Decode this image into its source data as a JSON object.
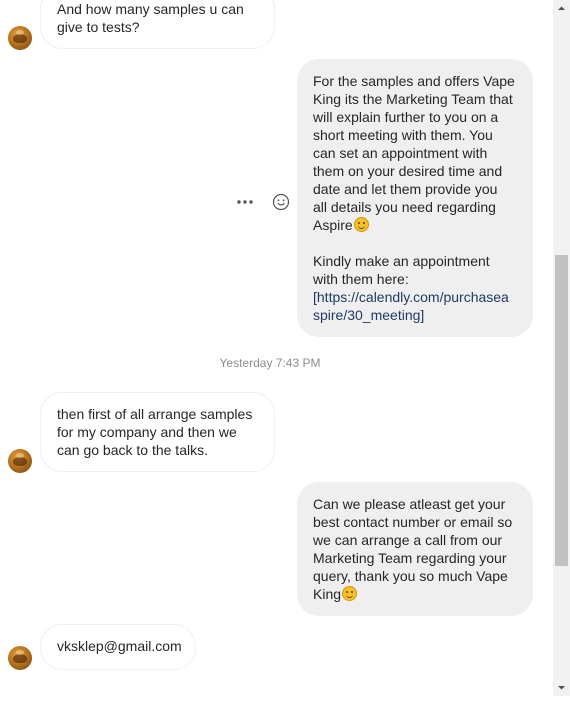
{
  "messages": [
    {
      "direction": "incoming",
      "lines": [
        "And how many samples u can",
        "give to tests?"
      ]
    },
    {
      "direction": "outgoing",
      "lines": [
        "For the samples and offers Vape",
        "King its the Marketing Team that",
        "will explain further to you on a",
        "short meeting with them. You",
        "can set an appointment with",
        "them on your desired time and",
        "date and let them provide you",
        "all details you need regarding",
        "Aspire"
      ],
      "lines2": [
        "Kindly make an appointment",
        "with them here:"
      ],
      "link_lines": [
        "[https://calendly.com/purchasea",
        "spire/30_meeting]"
      ]
    },
    {
      "direction": "incoming",
      "lines": [
        "then first of all arrange samples",
        "for my company and then we",
        "can go back to the talks."
      ]
    },
    {
      "direction": "outgoing",
      "lines": [
        "Can we please atleast get your",
        "best contact number or email so",
        "we can arrange a call from our",
        "Marketing Team regarding your",
        "query, thank you so much Vape",
        "King"
      ]
    },
    {
      "direction": "incoming",
      "lines": [
        "vksklep@gmail.com"
      ]
    }
  ],
  "timestamp": "Yesterday 7:43 PM",
  "icons": {
    "more": "more-options-icon",
    "react": "emoji-reaction-icon",
    "emoji": "smiling-face-emoji",
    "avatar": "contact-avatar"
  },
  "colors": {
    "outgoing_bubble": "#efefef",
    "incoming_border": "#efefef",
    "timestamp": "#8e8e8e",
    "link": "#1f3b63"
  },
  "scrollbar": {
    "thumb_start_fraction": 0.36,
    "thumb_size_fraction": 0.47
  }
}
